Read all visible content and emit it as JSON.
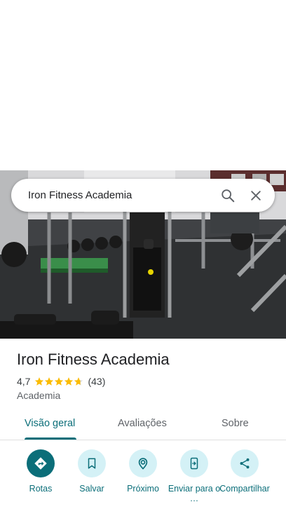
{
  "search": {
    "query": "Iron Fitness Academia"
  },
  "place": {
    "name": "Iron Fitness Academia",
    "rating": "4,7",
    "stars": 4.7,
    "reviews": "(43)",
    "category": "Academia"
  },
  "tabs": [
    {
      "label": "Visão geral"
    },
    {
      "label": "Avaliações"
    },
    {
      "label": "Sobre"
    }
  ],
  "actions": [
    {
      "label": "Rotas",
      "icon": "directions-icon"
    },
    {
      "label": "Salvar",
      "icon": "bookmark-icon"
    },
    {
      "label": "Próximo",
      "icon": "nearby-icon"
    },
    {
      "label": "Enviar para o …",
      "icon": "send-to-phone-icon"
    },
    {
      "label": "Compartilhar",
      "icon": "share-icon"
    }
  ],
  "colors": {
    "accent": "#0b6e79",
    "chip": "#d4f1f6",
    "star": "#fbbc04"
  }
}
